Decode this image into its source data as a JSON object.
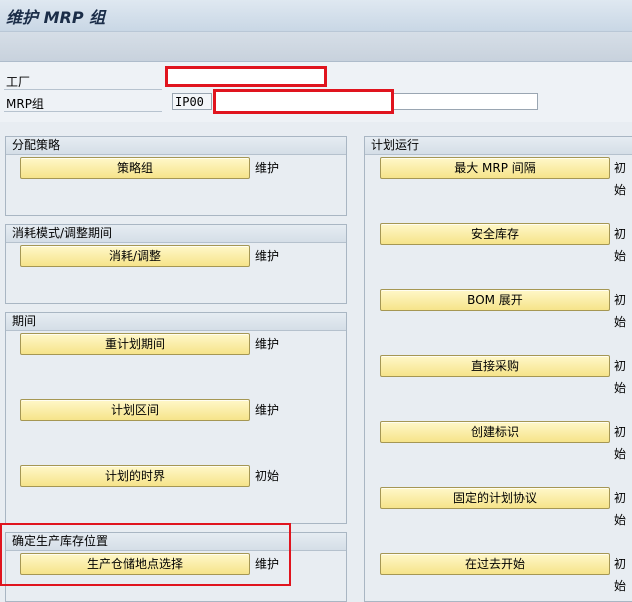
{
  "window": {
    "title": "维护 MRP 组"
  },
  "header": {
    "plant_label": "工厂",
    "mrp_group_label": "MRP组",
    "mrp_group_value": "IP00"
  },
  "groups": {
    "strategy": {
      "title": "分配策略",
      "btn": "策略组",
      "act": "维护"
    },
    "consumption": {
      "title": "消耗模式/调整期间",
      "btn": "消耗/调整",
      "act": "维护"
    },
    "periods": {
      "title": "期间",
      "items": [
        {
          "btn": "重计划期间",
          "act": "维护"
        },
        {
          "btn": "计划区间",
          "act": "维护"
        },
        {
          "btn": "计划的时界",
          "act": "初始"
        }
      ]
    },
    "storage": {
      "title": "确定生产库存位置",
      "btn": "生产仓储地点选择",
      "act": "维护"
    },
    "planning_run": {
      "title": "计划运行",
      "items": [
        {
          "btn": "最大 MRP 间隔",
          "act": "初始"
        },
        {
          "btn": "安全库存",
          "act": "初始"
        },
        {
          "btn": "BOM 展开",
          "act": "初始"
        },
        {
          "btn": "直接采购",
          "act": "初始"
        },
        {
          "btn": "创建标识",
          "act": "初始"
        },
        {
          "btn": "固定的计划协议",
          "act": "初始"
        },
        {
          "btn": "在过去开始",
          "act": "初始"
        }
      ]
    }
  }
}
